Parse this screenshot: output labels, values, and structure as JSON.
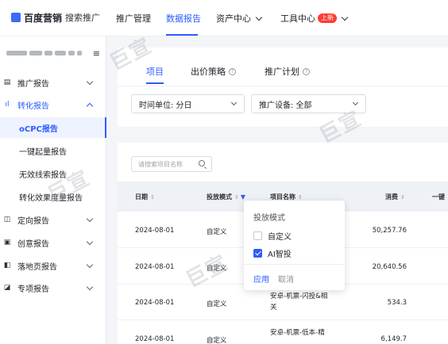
{
  "header": {
    "logo_text": "百度营销",
    "logo_sub": "搜索推广",
    "nav": [
      {
        "label": "推广管理"
      },
      {
        "label": "数据报告"
      },
      {
        "label": "资产中心"
      },
      {
        "label": "工具中心"
      }
    ],
    "new_badge": "上新"
  },
  "sidebar": {
    "menu_icon": "≡",
    "items": [
      {
        "label": "推广报告",
        "icon": "report-icon"
      },
      {
        "label": "转化报告",
        "icon": "chart-icon"
      },
      {
        "label": "定向报告",
        "icon": "target-icon"
      },
      {
        "label": "创意报告",
        "icon": "creative-icon"
      },
      {
        "label": "落地页报告",
        "icon": "page-icon"
      },
      {
        "label": "专项报告",
        "icon": "special-icon"
      }
    ],
    "sub_items": [
      {
        "label": "oCPC报告"
      },
      {
        "label": "一键起量报告"
      },
      {
        "label": "无效线索报告"
      },
      {
        "label": "转化效果度量报告"
      }
    ]
  },
  "main": {
    "tabs": [
      {
        "label": "项目"
      },
      {
        "label": "出价策略"
      },
      {
        "label": "推广计划"
      }
    ],
    "filters": {
      "time_unit": "时间单位: 分日",
      "device": "推广设备: 全部"
    },
    "search_placeholder": "请搜索项目名称",
    "columns": [
      "日期",
      "投放模式",
      "项目名称",
      "消费",
      "一键"
    ],
    "rows": [
      {
        "date": "2024-08-01",
        "mode": "自定义",
        "name": "",
        "cost": "50,257.76"
      },
      {
        "date": "2024-08-01",
        "mode": "自定义",
        "name": "",
        "cost": "20,640.56"
      },
      {
        "date": "2024-08-01",
        "mode": "自定义",
        "name": "安卓-机票-闪投&相关",
        "cost": "534.3"
      },
      {
        "date": "2024-08-01",
        "mode": "自定义",
        "name": "安卓-机票-低本-精",
        "cost": "6,149.7"
      }
    ]
  },
  "filter_popover": {
    "title": "投放模式",
    "options": [
      {
        "label": "自定义",
        "checked": false
      },
      {
        "label": "AI智投",
        "checked": true
      }
    ],
    "apply": "应用",
    "cancel": "取消"
  },
  "watermark": "巨宣",
  "colors": {
    "accent": "#2d5bff",
    "badge": "#ff3b30"
  }
}
